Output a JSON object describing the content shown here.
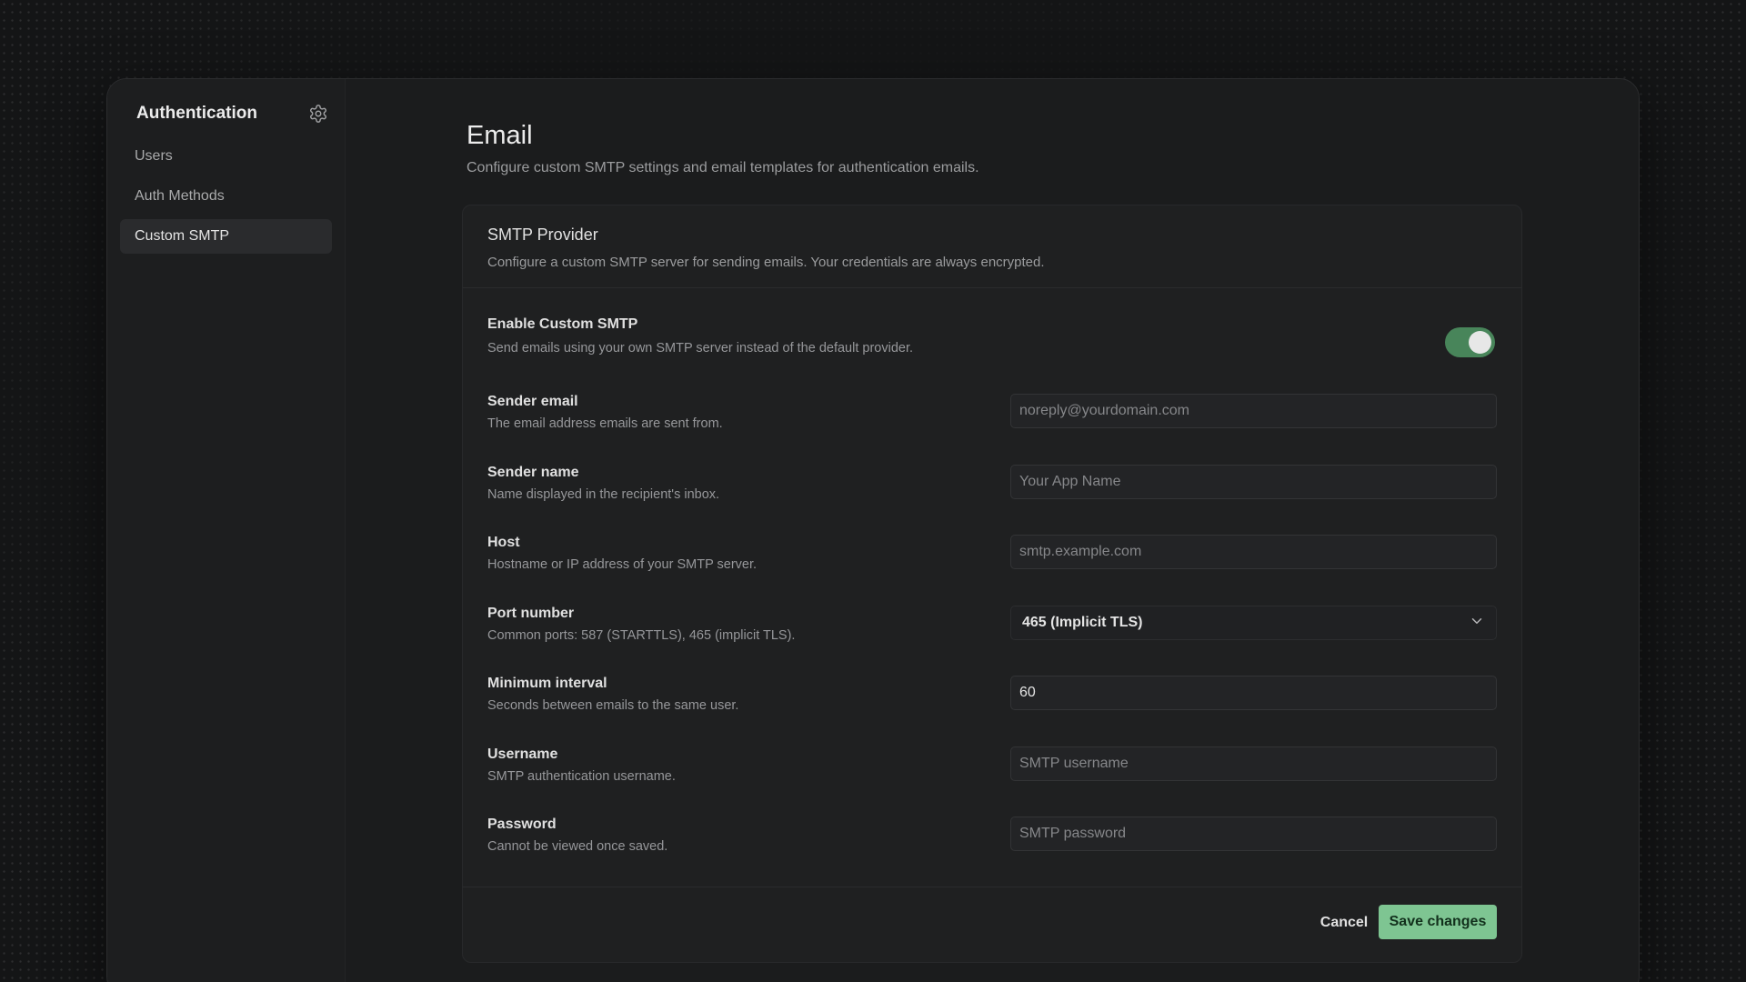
{
  "sidebar": {
    "title": "Authentication",
    "settings_icon": "gear-icon",
    "items": [
      {
        "label": "Users",
        "active": false
      },
      {
        "label": "Auth Methods",
        "active": false
      },
      {
        "label": "Custom SMTP",
        "active": true
      }
    ]
  },
  "page": {
    "title": "Email",
    "subtitle": "Configure custom SMTP settings and email templates for authentication emails."
  },
  "smtp_card": {
    "title": "SMTP Provider",
    "description": "Configure a custom SMTP server for sending emails. Your credentials are always encrypted.",
    "enable": {
      "label": "Enable Custom SMTP",
      "help": "Send emails using your own SMTP server instead of the default provider.",
      "enabled": true
    },
    "fields": {
      "sender_email": {
        "label": "Sender email",
        "help": "The email address emails are sent from.",
        "placeholder": "noreply@yourdomain.com",
        "value": ""
      },
      "sender_name": {
        "label": "Sender name",
        "help": "Name displayed in the recipient's inbox.",
        "placeholder": "Your App Name",
        "value": ""
      },
      "host": {
        "label": "Host",
        "help": "Hostname or IP address of your SMTP server.",
        "placeholder": "smtp.example.com",
        "value": ""
      },
      "port": {
        "label": "Port number",
        "help": "Common ports: 587 (STARTTLS), 465 (implicit TLS).",
        "selected": "465 (Implicit TLS)"
      },
      "min_interval": {
        "label": "Minimum interval",
        "help": "Seconds between emails to the same user.",
        "value": "60"
      },
      "username": {
        "label": "Username",
        "help": "SMTP authentication username.",
        "placeholder": "SMTP username",
        "value": ""
      },
      "password": {
        "label": "Password",
        "help": "Cannot be viewed once saved.",
        "placeholder": "SMTP password",
        "value": ""
      }
    },
    "actions": {
      "cancel": "Cancel",
      "save": "Save changes"
    }
  },
  "colors": {
    "accent_green": "#7ec592",
    "toggle_on": "#48855a",
    "background": "#141516",
    "panel": "#1f2021"
  }
}
